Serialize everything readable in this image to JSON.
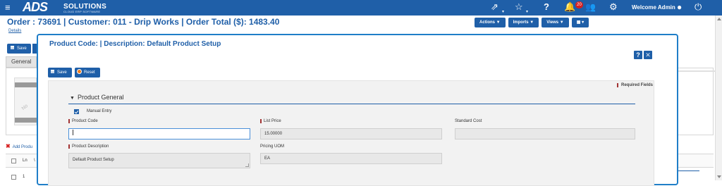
{
  "header": {
    "logo_main": "ADS",
    "logo_solutions": "SOLUTIONS",
    "logo_subtitle": "CLOUD ERP SOFTWARE",
    "notification_count": "20",
    "welcome_text": "Welcome Admin"
  },
  "order": {
    "title": "Order : 73691 | Customer: 011 - Drip Works | Order Total ($): 1483.40",
    "details_link": "Details",
    "actions": [
      {
        "label": "Actions ▼"
      },
      {
        "label": "Imports ▼"
      },
      {
        "label": "Views ▼"
      },
      {
        "label": "▦ ▾"
      }
    ]
  },
  "background": {
    "save_label": "Save",
    "tab_general": "General",
    "image_placeholder_text": "No",
    "add_product_link": "Add Produ",
    "table_header_ln": "Ln",
    "table_header_next": "\\",
    "row_number": "1"
  },
  "modal": {
    "title": "Product Code: | Description: Default Product Setup",
    "help_label": "?",
    "close_label": "✕",
    "save_label": "Save",
    "reset_label": "Reset",
    "required_fields_note": "Required Fields",
    "section_title": "Product General",
    "manual_entry_label": "Manual Entry",
    "manual_entry_checked": true,
    "fields": {
      "product_code": {
        "label": "Product Code",
        "value": ""
      },
      "list_price": {
        "label": "List Price",
        "value": "15.00000"
      },
      "standard_cost": {
        "label": "Standard Cost",
        "value": ""
      },
      "product_description": {
        "label": "Product Description",
        "value": "Default Product Setup"
      },
      "pricing_uom": {
        "label": "Pricing UOM",
        "value": "EA"
      }
    }
  },
  "colors": {
    "brand_blue": "#1f5fa8",
    "modal_border": "#1f7ec8",
    "required_marker": "#a23333",
    "badge_red": "#d62020"
  }
}
